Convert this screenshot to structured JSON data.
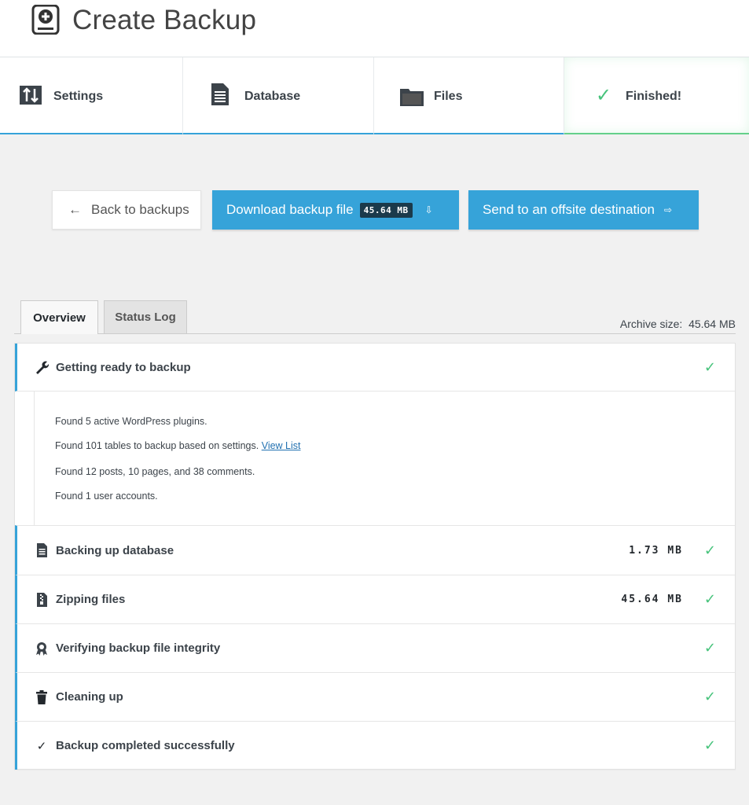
{
  "header": {
    "title": "Create Backup",
    "logo_icon": "backup-drive-icon"
  },
  "steps": [
    {
      "label": "Settings",
      "icon": "sliders-icon",
      "state": "done"
    },
    {
      "label": "Database",
      "icon": "document-icon",
      "state": "done"
    },
    {
      "label": "Files",
      "icon": "folder-icon",
      "state": "done"
    },
    {
      "label": "Finished!",
      "icon": "check-icon",
      "state": "active"
    }
  ],
  "actions": {
    "back_label": "Back to backups",
    "back_arrow": "←",
    "download_label": "Download backup file",
    "download_size": "45.64 MB",
    "download_icon": "⇩",
    "send_label": "Send to an offsite destination",
    "send_icon": "⇨"
  },
  "tabs": {
    "overview": "Overview",
    "status_log": "Status Log",
    "active": "Overview"
  },
  "archive": {
    "label": "Archive size:",
    "value": "45.64 MB"
  },
  "rows": [
    {
      "label": "Getting ready to backup",
      "icon": "wrench-icon",
      "size": "",
      "status": "✓"
    },
    {
      "label": "Backing up database",
      "icon": "database-doc-icon",
      "size": "1.73 MB",
      "status": "✓"
    },
    {
      "label": "Zipping files",
      "icon": "zip-file-icon",
      "size": "45.64 MB",
      "status": "✓"
    },
    {
      "label": "Verifying backup file integrity",
      "icon": "award-ribbon-icon",
      "size": "",
      "status": "✓"
    },
    {
      "label": "Cleaning up",
      "icon": "trash-icon",
      "size": "",
      "status": "✓"
    },
    {
      "label": "Backup completed successfully",
      "icon": "check-icon",
      "size": "",
      "status": "✓"
    }
  ],
  "details": {
    "line1": "Found 5 active WordPress plugins.",
    "line2_text": "Found 101 tables to backup based on settings.",
    "line2_link": "View List",
    "line3": "Found 12 posts, 10 pages, and 38 comments.",
    "line4": "Found 1 user accounts."
  },
  "colors": {
    "accent": "#36a3d9",
    "success": "#46c37b",
    "badge_bg": "#1b3a4b",
    "background": "#f1f1f1"
  }
}
